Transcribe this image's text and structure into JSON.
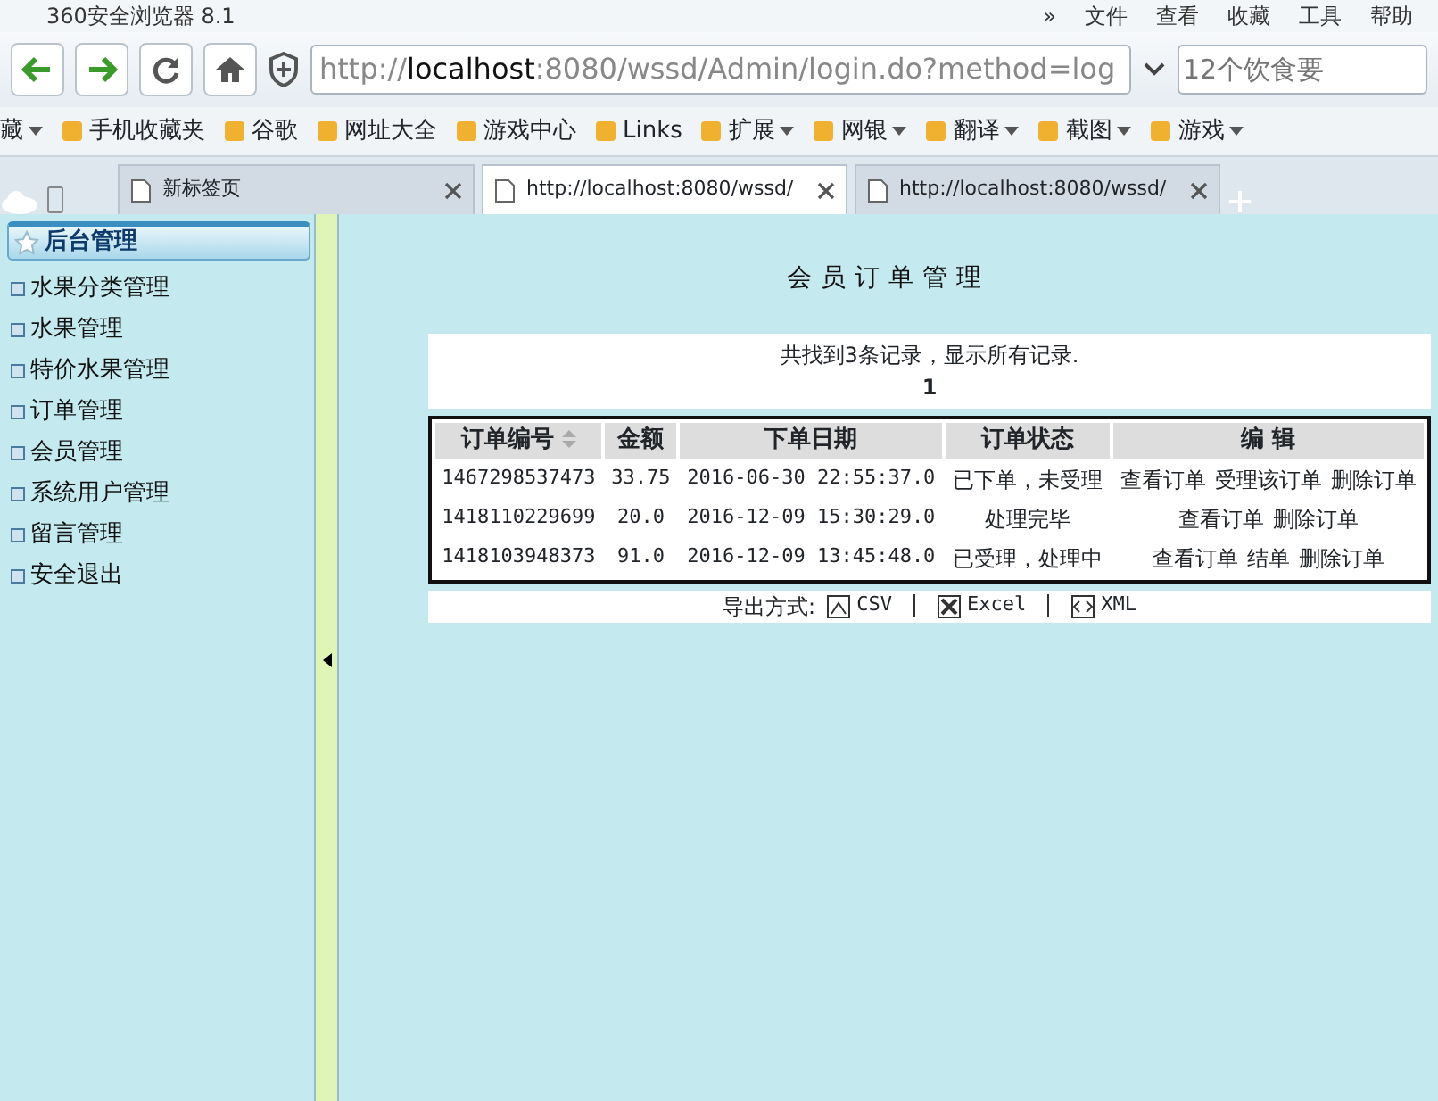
{
  "window": {
    "title": "360安全浏览器 8.1"
  },
  "menu": [
    "»",
    "文件",
    "查看",
    "收藏",
    "工具",
    "帮助"
  ],
  "address": {
    "url": "http://**localhost**:8080/wssd/Admin/login.do?method=log"
  },
  "search": {
    "placeholder": "12个饮食要"
  },
  "bookmarks": [
    {
      "label": "藏",
      "dropdown": true
    },
    {
      "label": "手机收藏夹",
      "dropdown": false
    },
    {
      "label": "谷歌",
      "dropdown": false
    },
    {
      "label": "网址大全",
      "dropdown": false
    },
    {
      "label": "游戏中心",
      "dropdown": false
    },
    {
      "label": "Links",
      "dropdown": false
    },
    {
      "label": "扩展",
      "dropdown": true
    },
    {
      "label": "网银",
      "dropdown": true
    },
    {
      "label": "翻译",
      "dropdown": true
    },
    {
      "label": "截图",
      "dropdown": true
    },
    {
      "label": "游戏",
      "dropdown": true
    }
  ],
  "tabs": [
    {
      "label": "新标签页",
      "selected": false
    },
    {
      "label": "http://localhost:8080/wssd/",
      "selected": true
    },
    {
      "label": "http://localhost:8080/wssd/",
      "selected": false
    }
  ],
  "sidebar": {
    "header": "后台管理",
    "items": [
      "水果分类管理",
      "水果管理",
      "特价水果管理",
      "订单管理",
      "会员管理",
      "系统用户管理",
      "留言管理",
      "安全退出"
    ]
  },
  "main": {
    "title": "会员订单管理",
    "summary": "共找到3条记录，显示所有记录.",
    "page": "1",
    "table": {
      "columns": [
        "订单编号",
        "金额",
        "下单日期",
        "订单状态",
        "编 辑"
      ],
      "rows": [
        {
          "cells": [
            "1467298537473",
            "33.75",
            "2016-06-30 22:55:37.0",
            "已下单，未受理"
          ],
          "actions": [
            "查看订单",
            "受理该订单",
            "删除订单"
          ]
        },
        {
          "cells": [
            "1418110229699",
            "20.0",
            "2016-12-09 15:30:29.0",
            "处理完毕"
          ],
          "actions": [
            "查看订单",
            "删除订单"
          ]
        },
        {
          "cells": [
            "1418103948373",
            "91.0",
            "2016-12-09 13:45:48.0",
            "已受理，处理中"
          ],
          "actions": [
            "查看订单",
            "结单",
            "删除订单"
          ]
        }
      ]
    },
    "export": {
      "label": "导出方式:",
      "options": [
        "CSV",
        "Excel",
        "XML"
      ]
    }
  }
}
